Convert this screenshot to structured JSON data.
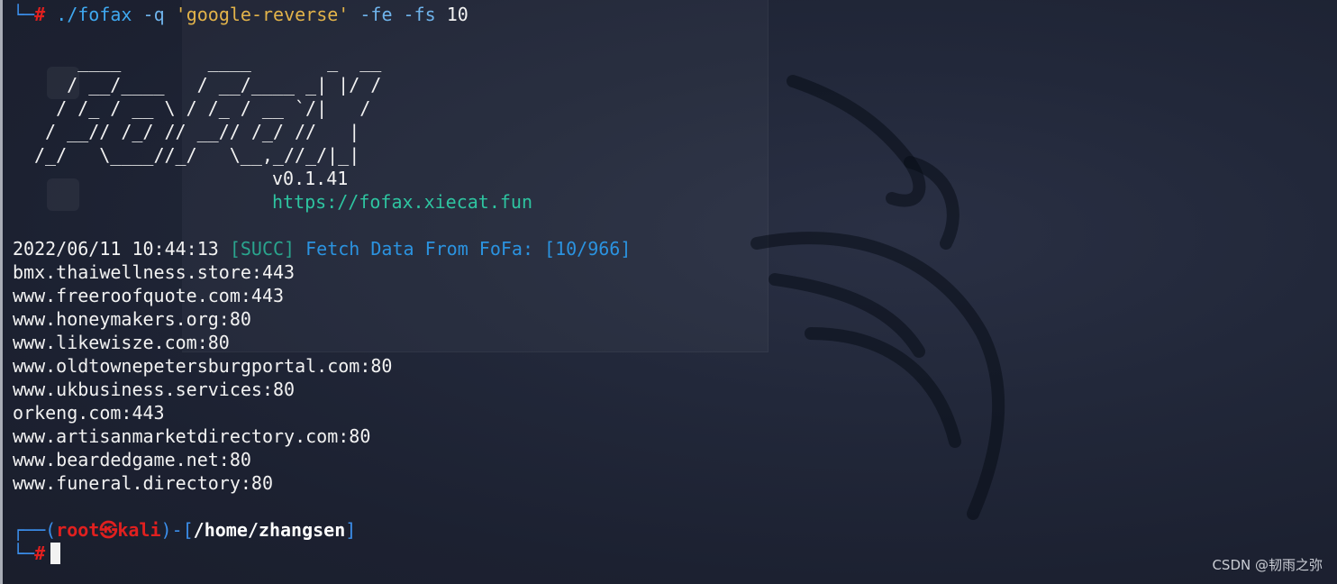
{
  "command": {
    "prompt_corner": "└─",
    "prompt_hash": "#",
    "program": "./fofax",
    "flag_q": "-q",
    "query": "'google-reverse'",
    "flags": "-fe -fs",
    "count": "10"
  },
  "banner": {
    "ascii": [
      "    ____        ____       _  __",
      "   / __/____   / __/____ _| |/ /",
      "  / /_ / __ \\ / /_ / __ `/|   /",
      " / __// /_/ // __// /_/ //   |",
      "/_/   \\____//_/   \\__,_//_/|_|"
    ],
    "version": "v0.1.41",
    "url": "https://fofax.xiecat.fun"
  },
  "status": {
    "timestamp": "2022/06/11 10:44:13",
    "tag": "[SUCC]",
    "message": "Fetch Data From FoFa: [10/966]"
  },
  "results": [
    "bmx.thaiwellness.store:443",
    "www.freeroofquote.com:443",
    "www.honeymakers.org:80",
    "www.likewisze.com:80",
    "www.oldtownepetersburgportal.com:80",
    "www.ukbusiness.services:80",
    "orkeng.com:443",
    "www.artisanmarketdirectory.com:80",
    "www.beardedgame.net:80",
    "www.funeral.directory:80"
  ],
  "next_prompt": {
    "corner_top": "┌──",
    "open_paren": "(",
    "user": "root",
    "at_symbol": "㉿",
    "host": "kali",
    "close_paren": ")",
    "separator": "-[",
    "path": "/home/zhangsen",
    "close_bracket": "]",
    "corner_bottom": "└─",
    "hash": "#"
  },
  "watermark": "CSDN @韧雨之弥",
  "colors": {
    "background": "#1c2030",
    "prompt_blue": "#3b8eea",
    "root_red": "#e0201f",
    "string_yellow": "#e2b34a",
    "url_green": "#2ec4a0",
    "succ_teal": "#2aa58e",
    "succ_blue": "#2b93e0"
  }
}
